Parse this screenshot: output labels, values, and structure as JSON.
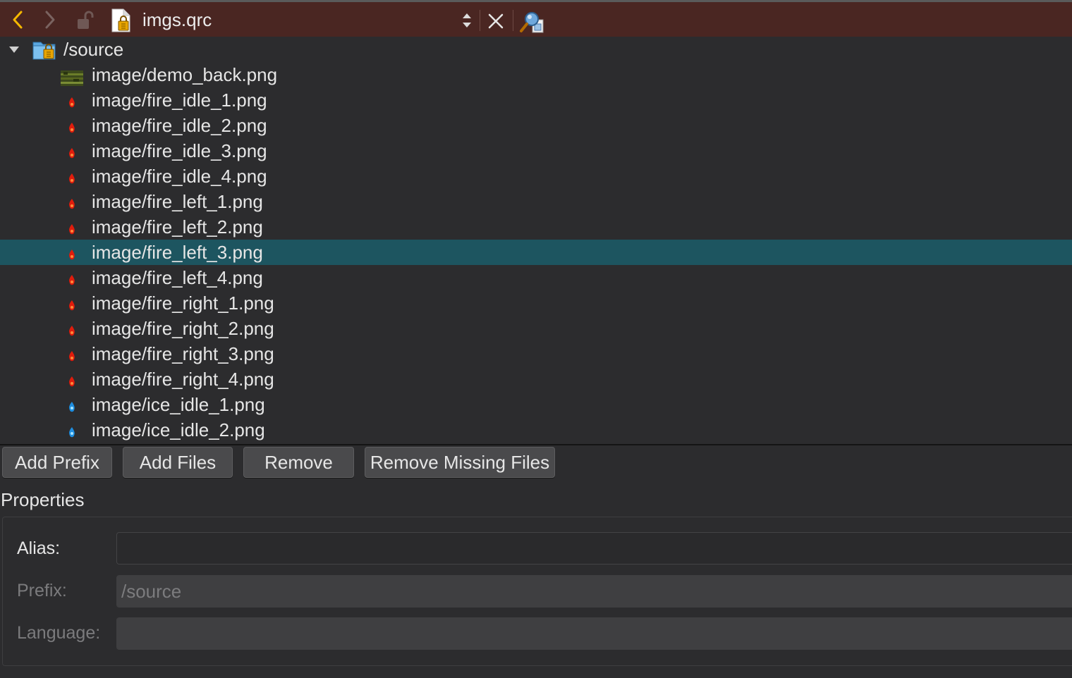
{
  "toolbar": {
    "file_name": "imgs.qrc",
    "icons": [
      "back-arrow-icon",
      "forward-arrow-icon",
      "lock-icon",
      "qrc-file-icon",
      "up-down-arrows-icon",
      "close-icon",
      "split-editor-icon"
    ],
    "accent_color": "#f5b800"
  },
  "tree": {
    "root": {
      "label": "/source",
      "expanded": true
    },
    "items": [
      {
        "label": "image/demo_back.png",
        "thumb": "landscape"
      },
      {
        "label": "image/fire_idle_1.png",
        "thumb": "fire"
      },
      {
        "label": "image/fire_idle_2.png",
        "thumb": "fire"
      },
      {
        "label": "image/fire_idle_3.png",
        "thumb": "fire"
      },
      {
        "label": "image/fire_idle_4.png",
        "thumb": "fire"
      },
      {
        "label": "image/fire_left_1.png",
        "thumb": "fire"
      },
      {
        "label": "image/fire_left_2.png",
        "thumb": "fire"
      },
      {
        "label": "image/fire_left_3.png",
        "thumb": "fire",
        "selected": true
      },
      {
        "label": "image/fire_left_4.png",
        "thumb": "fire"
      },
      {
        "label": "image/fire_right_1.png",
        "thumb": "fire"
      },
      {
        "label": "image/fire_right_2.png",
        "thumb": "fire"
      },
      {
        "label": "image/fire_right_3.png",
        "thumb": "fire"
      },
      {
        "label": "image/fire_right_4.png",
        "thumb": "fire"
      },
      {
        "label": "image/ice_idle_1.png",
        "thumb": "ice"
      },
      {
        "label": "image/ice_idle_2.png",
        "thumb": "ice"
      }
    ],
    "selection_color": "#1d5560"
  },
  "buttons": {
    "add_prefix": "Add Prefix",
    "add_files": "Add Files",
    "remove": "Remove",
    "remove_missing": "Remove Missing Files"
  },
  "properties": {
    "title": "Properties",
    "alias_label": "Alias:",
    "alias_value": "",
    "prefix_label": "Prefix:",
    "prefix_value": "/source",
    "language_label": "Language:",
    "language_value": ""
  }
}
